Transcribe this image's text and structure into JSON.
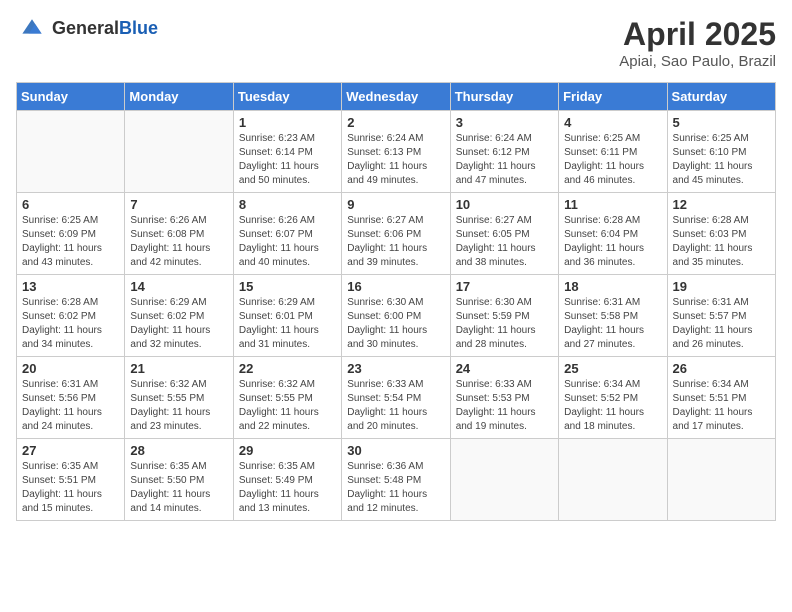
{
  "header": {
    "logo_general": "General",
    "logo_blue": "Blue",
    "title": "April 2025",
    "location": "Apiai, Sao Paulo, Brazil"
  },
  "days_of_week": [
    "Sunday",
    "Monday",
    "Tuesday",
    "Wednesday",
    "Thursday",
    "Friday",
    "Saturday"
  ],
  "weeks": [
    [
      {
        "num": "",
        "sunrise": "",
        "sunset": "",
        "daylight": ""
      },
      {
        "num": "",
        "sunrise": "",
        "sunset": "",
        "daylight": ""
      },
      {
        "num": "1",
        "sunrise": "Sunrise: 6:23 AM",
        "sunset": "Sunset: 6:14 PM",
        "daylight": "Daylight: 11 hours and 50 minutes."
      },
      {
        "num": "2",
        "sunrise": "Sunrise: 6:24 AM",
        "sunset": "Sunset: 6:13 PM",
        "daylight": "Daylight: 11 hours and 49 minutes."
      },
      {
        "num": "3",
        "sunrise": "Sunrise: 6:24 AM",
        "sunset": "Sunset: 6:12 PM",
        "daylight": "Daylight: 11 hours and 47 minutes."
      },
      {
        "num": "4",
        "sunrise": "Sunrise: 6:25 AM",
        "sunset": "Sunset: 6:11 PM",
        "daylight": "Daylight: 11 hours and 46 minutes."
      },
      {
        "num": "5",
        "sunrise": "Sunrise: 6:25 AM",
        "sunset": "Sunset: 6:10 PM",
        "daylight": "Daylight: 11 hours and 45 minutes."
      }
    ],
    [
      {
        "num": "6",
        "sunrise": "Sunrise: 6:25 AM",
        "sunset": "Sunset: 6:09 PM",
        "daylight": "Daylight: 11 hours and 43 minutes."
      },
      {
        "num": "7",
        "sunrise": "Sunrise: 6:26 AM",
        "sunset": "Sunset: 6:08 PM",
        "daylight": "Daylight: 11 hours and 42 minutes."
      },
      {
        "num": "8",
        "sunrise": "Sunrise: 6:26 AM",
        "sunset": "Sunset: 6:07 PM",
        "daylight": "Daylight: 11 hours and 40 minutes."
      },
      {
        "num": "9",
        "sunrise": "Sunrise: 6:27 AM",
        "sunset": "Sunset: 6:06 PM",
        "daylight": "Daylight: 11 hours and 39 minutes."
      },
      {
        "num": "10",
        "sunrise": "Sunrise: 6:27 AM",
        "sunset": "Sunset: 6:05 PM",
        "daylight": "Daylight: 11 hours and 38 minutes."
      },
      {
        "num": "11",
        "sunrise": "Sunrise: 6:28 AM",
        "sunset": "Sunset: 6:04 PM",
        "daylight": "Daylight: 11 hours and 36 minutes."
      },
      {
        "num": "12",
        "sunrise": "Sunrise: 6:28 AM",
        "sunset": "Sunset: 6:03 PM",
        "daylight": "Daylight: 11 hours and 35 minutes."
      }
    ],
    [
      {
        "num": "13",
        "sunrise": "Sunrise: 6:28 AM",
        "sunset": "Sunset: 6:02 PM",
        "daylight": "Daylight: 11 hours and 34 minutes."
      },
      {
        "num": "14",
        "sunrise": "Sunrise: 6:29 AM",
        "sunset": "Sunset: 6:02 PM",
        "daylight": "Daylight: 11 hours and 32 minutes."
      },
      {
        "num": "15",
        "sunrise": "Sunrise: 6:29 AM",
        "sunset": "Sunset: 6:01 PM",
        "daylight": "Daylight: 11 hours and 31 minutes."
      },
      {
        "num": "16",
        "sunrise": "Sunrise: 6:30 AM",
        "sunset": "Sunset: 6:00 PM",
        "daylight": "Daylight: 11 hours and 30 minutes."
      },
      {
        "num": "17",
        "sunrise": "Sunrise: 6:30 AM",
        "sunset": "Sunset: 5:59 PM",
        "daylight": "Daylight: 11 hours and 28 minutes."
      },
      {
        "num": "18",
        "sunrise": "Sunrise: 6:31 AM",
        "sunset": "Sunset: 5:58 PM",
        "daylight": "Daylight: 11 hours and 27 minutes."
      },
      {
        "num": "19",
        "sunrise": "Sunrise: 6:31 AM",
        "sunset": "Sunset: 5:57 PM",
        "daylight": "Daylight: 11 hours and 26 minutes."
      }
    ],
    [
      {
        "num": "20",
        "sunrise": "Sunrise: 6:31 AM",
        "sunset": "Sunset: 5:56 PM",
        "daylight": "Daylight: 11 hours and 24 minutes."
      },
      {
        "num": "21",
        "sunrise": "Sunrise: 6:32 AM",
        "sunset": "Sunset: 5:55 PM",
        "daylight": "Daylight: 11 hours and 23 minutes."
      },
      {
        "num": "22",
        "sunrise": "Sunrise: 6:32 AM",
        "sunset": "Sunset: 5:55 PM",
        "daylight": "Daylight: 11 hours and 22 minutes."
      },
      {
        "num": "23",
        "sunrise": "Sunrise: 6:33 AM",
        "sunset": "Sunset: 5:54 PM",
        "daylight": "Daylight: 11 hours and 20 minutes."
      },
      {
        "num": "24",
        "sunrise": "Sunrise: 6:33 AM",
        "sunset": "Sunset: 5:53 PM",
        "daylight": "Daylight: 11 hours and 19 minutes."
      },
      {
        "num": "25",
        "sunrise": "Sunrise: 6:34 AM",
        "sunset": "Sunset: 5:52 PM",
        "daylight": "Daylight: 11 hours and 18 minutes."
      },
      {
        "num": "26",
        "sunrise": "Sunrise: 6:34 AM",
        "sunset": "Sunset: 5:51 PM",
        "daylight": "Daylight: 11 hours and 17 minutes."
      }
    ],
    [
      {
        "num": "27",
        "sunrise": "Sunrise: 6:35 AM",
        "sunset": "Sunset: 5:51 PM",
        "daylight": "Daylight: 11 hours and 15 minutes."
      },
      {
        "num": "28",
        "sunrise": "Sunrise: 6:35 AM",
        "sunset": "Sunset: 5:50 PM",
        "daylight": "Daylight: 11 hours and 14 minutes."
      },
      {
        "num": "29",
        "sunrise": "Sunrise: 6:35 AM",
        "sunset": "Sunset: 5:49 PM",
        "daylight": "Daylight: 11 hours and 13 minutes."
      },
      {
        "num": "30",
        "sunrise": "Sunrise: 6:36 AM",
        "sunset": "Sunset: 5:48 PM",
        "daylight": "Daylight: 11 hours and 12 minutes."
      },
      {
        "num": "",
        "sunrise": "",
        "sunset": "",
        "daylight": ""
      },
      {
        "num": "",
        "sunrise": "",
        "sunset": "",
        "daylight": ""
      },
      {
        "num": "",
        "sunrise": "",
        "sunset": "",
        "daylight": ""
      }
    ]
  ]
}
